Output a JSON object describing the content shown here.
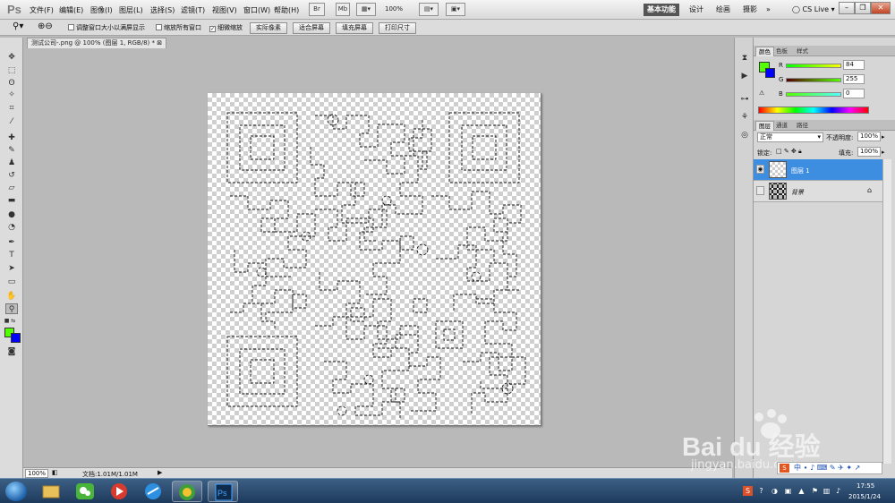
{
  "app": {
    "logo": "Ps"
  },
  "menu": [
    "文件(F)",
    "编辑(E)",
    "图像(I)",
    "图层(L)",
    "选择(S)",
    "滤镜(T)",
    "视图(V)",
    "窗口(W)",
    "帮助(H)"
  ],
  "appbar": {
    "zoom": "100%",
    "mb_label": "Mb",
    "workspaces": [
      "基本功能",
      "设计",
      "绘画",
      "摄影"
    ],
    "more": "»",
    "cs_live": "CS Live"
  },
  "options": {
    "resize_windows": "调整窗口大小以满屏显示",
    "zoom_all": "缩放所有窗口",
    "scrubby_zoom": "细微缩放",
    "actual_pixels": "实际像素",
    "fit_screen": "适合屏幕",
    "fill_screen": "填充屏幕",
    "print_size": "打印尺寸"
  },
  "document": {
    "tab_title": "测试公司-.png @ 100% (图层 1, RGB/8) *"
  },
  "status": {
    "zoom": "100%",
    "doc_size": "文档:1.01M/1.01M"
  },
  "color_panel": {
    "tabs": [
      "颜色",
      "色板",
      "样式"
    ],
    "channels": [
      {
        "label": "R",
        "value": "84"
      },
      {
        "label": "G",
        "value": "255"
      },
      {
        "label": "B",
        "value": "0"
      }
    ],
    "foreground": "#54ff00",
    "background": "#0000ff"
  },
  "layers_panel": {
    "tabs": [
      "图层",
      "通道",
      "路径"
    ],
    "blend_mode": "正常",
    "opacity_label": "不透明度:",
    "opacity": "100%",
    "lock_label": "锁定:",
    "fill_label": "填充:",
    "fill": "100%",
    "layers": [
      {
        "name": "图层 1",
        "visible": true,
        "selected": true
      },
      {
        "name": "背景",
        "visible": false,
        "selected": false,
        "locked": true
      }
    ]
  },
  "taskbar": {
    "time": "17:55",
    "date": "2015/1/24"
  },
  "watermark": {
    "logo": "Bai du 经验",
    "url": "jingyan.baidu.com",
    "ime": "中 ∙ ♪ ⌨ ✎ ✈ ✦ ↗"
  }
}
